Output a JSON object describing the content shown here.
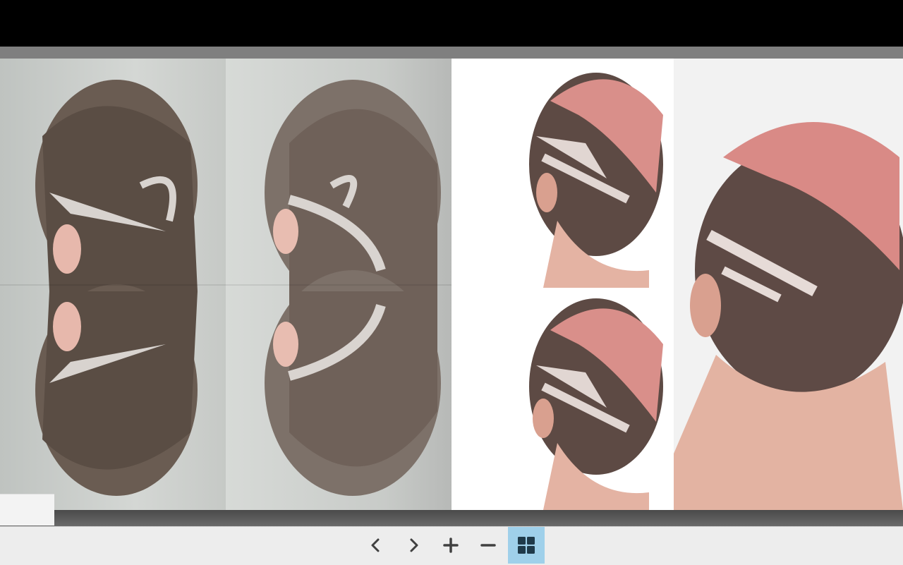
{
  "toolbar": {
    "buttons": [
      {
        "icon": "chevron-left-icon"
      },
      {
        "icon": "chevron-right-icon"
      },
      {
        "icon": "plus-icon"
      },
      {
        "icon": "minus-icon"
      },
      {
        "icon": "grid-view-icon",
        "active": true
      }
    ],
    "active_color": "#9fd0ea",
    "icon_color": "#404040"
  },
  "pages": [
    {
      "content": "photo",
      "description_hidden": true
    },
    {
      "content": "photo",
      "description_hidden": true
    }
  ]
}
